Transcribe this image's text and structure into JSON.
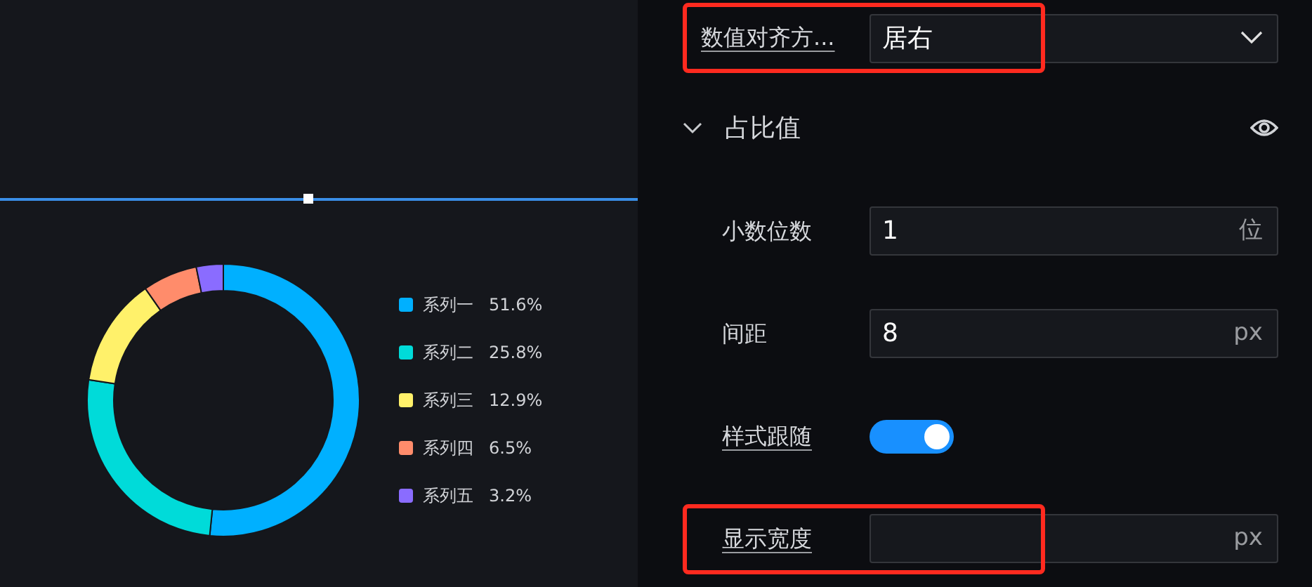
{
  "chart": {
    "chart_data": {
      "type": "donut",
      "categories": [
        "系列一",
        "系列二",
        "系列三",
        "系列四",
        "系列五"
      ],
      "values": [
        51.6,
        25.8,
        12.9,
        6.5,
        3.2
      ],
      "legend": true,
      "colors": [
        "#00b0ff",
        "#00dbd9",
        "#fff16a",
        "#ff8c6b",
        "#8a6cff"
      ],
      "value_labels": [
        "51.6%",
        "25.8%",
        "12.9%",
        "6.5%",
        "3.2%"
      ]
    }
  },
  "settings": {
    "top_row": {
      "kind": "select",
      "label": "数值对齐方...",
      "underlined": true,
      "value": "居右",
      "highlighted": true
    },
    "section": {
      "title": "占比值",
      "expanded": true,
      "visible": true,
      "rows": [
        {
          "kind": "input",
          "label": "小数位数",
          "underlined": false,
          "value": "1",
          "unit": "位",
          "highlighted": false
        },
        {
          "kind": "input",
          "label": "间距",
          "underlined": false,
          "value": "8",
          "unit": "px",
          "highlighted": false
        },
        {
          "kind": "toggle",
          "label": "样式跟随",
          "underlined": true,
          "on": true,
          "highlighted": false
        },
        {
          "kind": "input",
          "label": "显示宽度",
          "underlined": true,
          "value": "",
          "unit": "px",
          "highlighted": true
        }
      ]
    }
  }
}
